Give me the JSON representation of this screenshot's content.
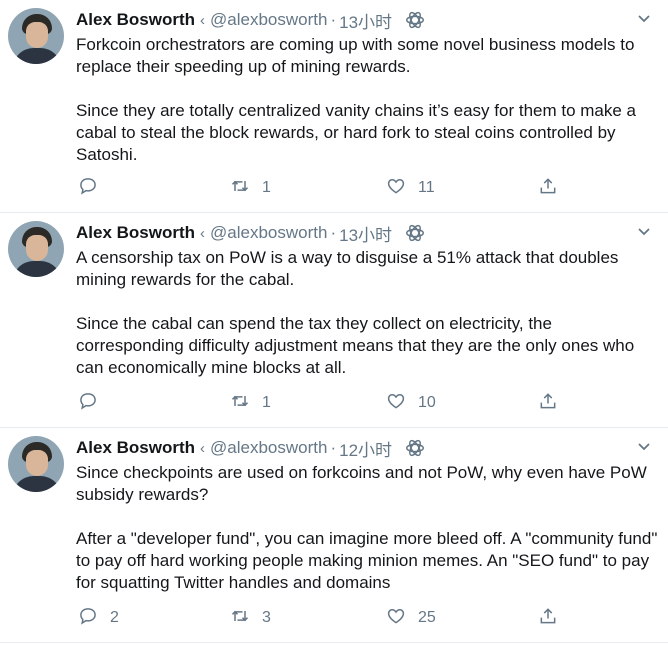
{
  "tweets": [
    {
      "name": "Alex Bosworth",
      "lt": "‹",
      "handle": "@alexbosworth",
      "dot": "·",
      "time": "13小时",
      "paragraphs": [
        "Forkcoin orchestrators are coming up with some novel business models to replace their speeding up of mining rewards.",
        "Since they are totally centralized vanity chains it’s easy for them to make a cabal to steal the block rewards, or hard fork to steal coins controlled by Satoshi."
      ],
      "reply_count": "",
      "retweet_count": "1",
      "like_count": "11"
    },
    {
      "name": "Alex Bosworth",
      "lt": "‹",
      "handle": "@alexbosworth",
      "dot": "·",
      "time": "13小时",
      "paragraphs": [
        "A censorship tax on PoW is a way to disguise a 51% attack that doubles mining rewards for the cabal.",
        "Since the cabal can spend the tax they collect on electricity, the corresponding difficulty adjustment means that they are the only ones who can economically mine blocks at all."
      ],
      "reply_count": "",
      "retweet_count": "1",
      "like_count": "10"
    },
    {
      "name": "Alex Bosworth",
      "lt": "‹",
      "handle": "@alexbosworth",
      "dot": "·",
      "time": "12小时",
      "paragraphs": [
        "Since checkpoints are used on forkcoins and not PoW, why even have PoW subsidy rewards?",
        "After a \"developer fund\", you can imagine more bleed off. A \"community fund\" to pay off hard working people making minion memes. An \"SEO fund\" to pay for squatting Twitter handles and domains"
      ],
      "reply_count": "2",
      "retweet_count": "3",
      "like_count": "25"
    }
  ],
  "icons": {
    "reply": "reply-icon",
    "retweet": "retweet-icon",
    "like": "heart-icon",
    "share": "share-icon",
    "menu": "chevron-down-icon",
    "app": "app-icon"
  },
  "colors": {
    "text": "#14171a",
    "secondary": "#657786",
    "divider": "#e6ecf0"
  }
}
